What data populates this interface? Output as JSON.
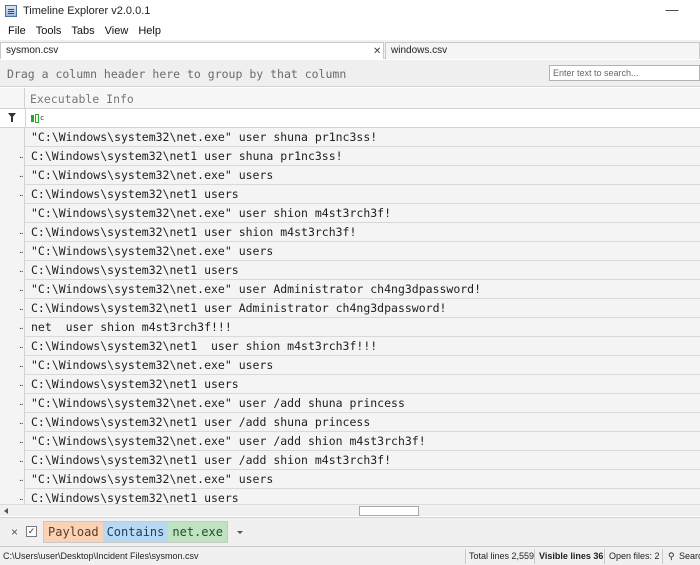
{
  "window": {
    "title": "Timeline Explorer v2.0.0.1",
    "minimize_glyph": "—"
  },
  "menu": [
    "File",
    "Tools",
    "Tabs",
    "View",
    "Help"
  ],
  "tabs": [
    {
      "label": "sysmon.csv",
      "active": true
    },
    {
      "label": "windows.csv",
      "active": false
    }
  ],
  "group_hint": "Drag a column header here to group by that column",
  "search": {
    "placeholder": "Enter text to search...",
    "value": ""
  },
  "grid": {
    "column": "Executable Info",
    "filter_row_icon": "filter-icon",
    "filter_operator_icon": "contains-operator-icon",
    "rows": [
      {
        "dots": "",
        "text": "\"C:\\Windows\\system32\\net.exe\" user shuna pr1nc3ss!"
      },
      {
        "dots": "..",
        "text": "C:\\Windows\\system32\\net1 user shuna pr1nc3ss!"
      },
      {
        "dots": "..",
        "text": "\"C:\\Windows\\system32\\net.exe\" users"
      },
      {
        "dots": "..",
        "text": "C:\\Windows\\system32\\net1 users"
      },
      {
        "dots": "",
        "text": "\"C:\\Windows\\system32\\net.exe\" user shion m4st3rch3f!"
      },
      {
        "dots": "..",
        "text": "C:\\Windows\\system32\\net1 user shion m4st3rch3f!"
      },
      {
        "dots": "..",
        "text": "\"C:\\Windows\\system32\\net.exe\" users"
      },
      {
        "dots": "..",
        "text": "C:\\Windows\\system32\\net1 users"
      },
      {
        "dots": "..",
        "text": "\"C:\\Windows\\system32\\net.exe\" user Administrator ch4ng3dpassword!"
      },
      {
        "dots": "..",
        "text": "C:\\Windows\\system32\\net1 user Administrator ch4ng3dpassword!"
      },
      {
        "dots": "..",
        "text": "net  user shion m4st3rch3f!!!"
      },
      {
        "dots": "..",
        "text": "C:\\Windows\\system32\\net1  user shion m4st3rch3f!!!"
      },
      {
        "dots": "..",
        "text": "\"C:\\Windows\\system32\\net.exe\" users"
      },
      {
        "dots": "..",
        "text": "C:\\Windows\\system32\\net1 users"
      },
      {
        "dots": "..",
        "text": "\"C:\\Windows\\system32\\net.exe\" user /add shuna princess"
      },
      {
        "dots": "..",
        "text": "C:\\Windows\\system32\\net1 user /add shuna princess"
      },
      {
        "dots": "..",
        "text": "\"C:\\Windows\\system32\\net.exe\" user /add shion m4st3rch3f!"
      },
      {
        "dots": "..",
        "text": "C:\\Windows\\system32\\net1 user /add shion m4st3rch3f!"
      },
      {
        "dots": "..",
        "text": "\"C:\\Windows\\system32\\net.exe\" users"
      },
      {
        "dots": "..",
        "text": "C:\\Windows\\system32\\net1 users"
      }
    ]
  },
  "filter_expression": {
    "clear_glyph": "×",
    "checked_glyph": "✓",
    "field": "Payload",
    "operator": "Contains",
    "value": "net.exe",
    "colors": {
      "field": "#fad3b6",
      "operator": "#b9d9f3",
      "value": "#bfe3c2"
    }
  },
  "status": {
    "path": "C:\\Users\\user\\Desktop\\Incident Files\\sysmon.csv",
    "total_lines": "Total lines 2,559",
    "visible_lines": "Visible lines 36",
    "open_files": "Open files: 2",
    "search_label": "Searc"
  }
}
